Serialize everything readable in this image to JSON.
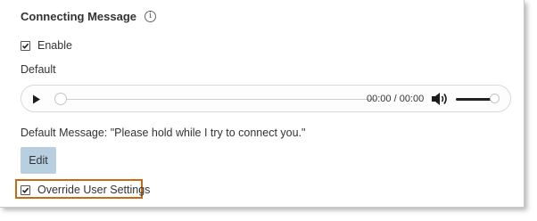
{
  "section": {
    "title": "Connecting Message",
    "info_icon": "info-circle-icon"
  },
  "enable": {
    "label": "Enable",
    "checked": true
  },
  "default_label": "Default",
  "player": {
    "time": "00:00 / 00:00",
    "play_icon": "play-icon",
    "volume_icon": "volume-icon",
    "progress": 0,
    "volume_level": 0.9
  },
  "default_message": "Default Message: \"Please hold while I try to connect you.\"",
  "edit_button": {
    "label": "Edit"
  },
  "override": {
    "label": "Override User Settings",
    "checked": true,
    "highlight_color": "#c76a16"
  },
  "colors": {
    "edit_button_bg": "#b8cfe0"
  }
}
